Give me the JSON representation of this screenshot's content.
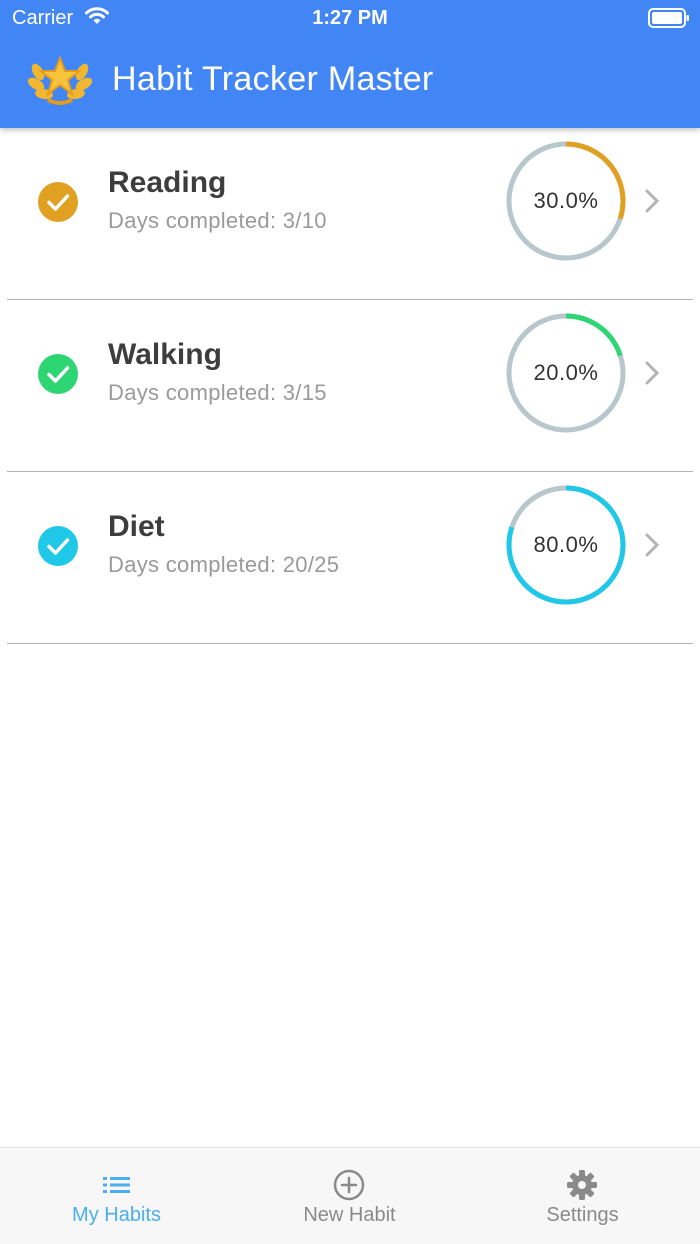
{
  "status_bar": {
    "carrier": "Carrier",
    "time": "1:27 PM"
  },
  "header": {
    "title": "Habit Tracker Master",
    "logo_icon": "laurel-star-icon"
  },
  "habits": [
    {
      "name": "Reading",
      "days_text": "Days completed: 3/10",
      "progress_label": "30.0%",
      "progress": 0.3,
      "color": "#e0a022"
    },
    {
      "name": "Walking",
      "days_text": "Days completed: 3/15",
      "progress_label": "20.0%",
      "progress": 0.2,
      "color": "#2ed573"
    },
    {
      "name": "Diet",
      "days_text": "Days completed: 20/25",
      "progress_label": "80.0%",
      "progress": 0.8,
      "color": "#1ec8e6"
    }
  ],
  "tabs": [
    {
      "label": "My Habits",
      "icon": "list-icon",
      "active": true
    },
    {
      "label": "New Habit",
      "icon": "plus-circle-icon",
      "active": false
    },
    {
      "label": "Settings",
      "icon": "gear-icon",
      "active": false
    }
  ],
  "colors": {
    "header_bg": "#4285f4",
    "ring_track": "#b8c7cc",
    "tab_active": "#4aaef0",
    "tab_inactive": "#8a8a8a"
  }
}
